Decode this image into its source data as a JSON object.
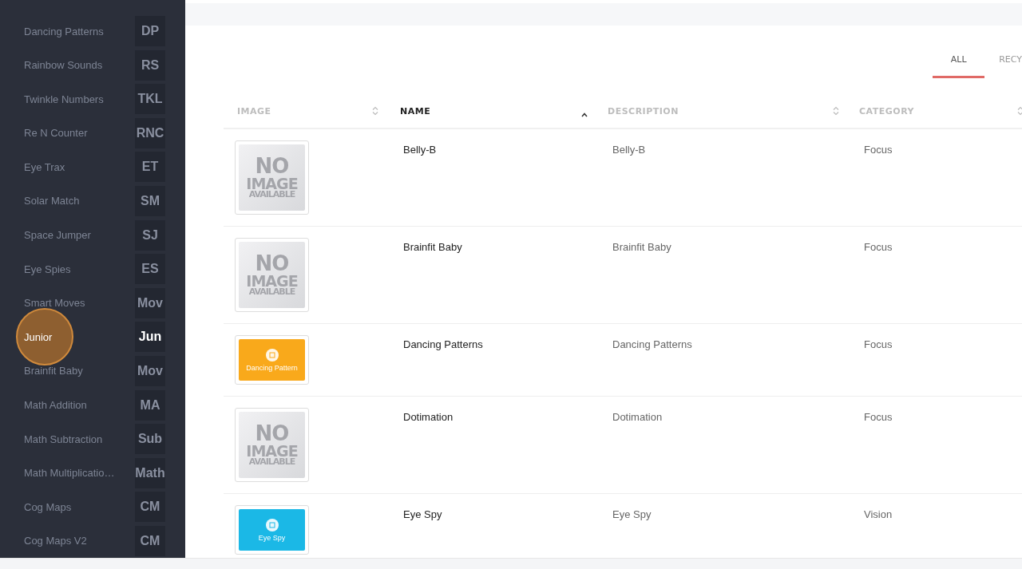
{
  "sidebar": {
    "items": [
      {
        "label": "Dancing Patterns",
        "abbr": "DP",
        "selected": false,
        "clicked": false
      },
      {
        "label": "Rainbow Sounds",
        "abbr": "RS",
        "selected": false,
        "clicked": false
      },
      {
        "label": "Twinkle Numbers",
        "abbr": "TKL",
        "selected": false,
        "clicked": false
      },
      {
        "label": "Re N Counter",
        "abbr": "RNC",
        "selected": false,
        "clicked": false
      },
      {
        "label": "Eye Trax",
        "abbr": "ET",
        "selected": false,
        "clicked": false
      },
      {
        "label": "Solar Match",
        "abbr": "SM",
        "selected": false,
        "clicked": false
      },
      {
        "label": "Space Jumper",
        "abbr": "SJ",
        "selected": false,
        "clicked": false
      },
      {
        "label": "Eye Spies",
        "abbr": "ES",
        "selected": false,
        "clicked": false
      },
      {
        "label": "Smart Moves",
        "abbr": "Mov",
        "selected": false,
        "clicked": false
      },
      {
        "label": "Junior",
        "abbr": "Jun",
        "selected": true,
        "clicked": true
      },
      {
        "label": "Brainfit Baby",
        "abbr": "Mov",
        "selected": false,
        "clicked": false
      },
      {
        "label": "Math Addition",
        "abbr": "MA",
        "selected": false,
        "clicked": false
      },
      {
        "label": "Math Subtraction",
        "abbr": "Sub",
        "selected": false,
        "clicked": false
      },
      {
        "label": "Math Multiplicatio…",
        "abbr": "Math",
        "selected": false,
        "clicked": false
      },
      {
        "label": "Cog Maps",
        "abbr": "CM",
        "selected": false,
        "clicked": false
      },
      {
        "label": "Cog Maps V2",
        "abbr": "CM",
        "selected": false,
        "clicked": false
      }
    ]
  },
  "tabs": [
    {
      "label": "ALL",
      "selected": true
    },
    {
      "label": "RECY",
      "selected": false
    }
  ],
  "table": {
    "columns": [
      {
        "label": "IMAGE",
        "sorted": false
      },
      {
        "label": "NAME",
        "sorted": true
      },
      {
        "label": "DESCRIPTION",
        "sorted": false
      },
      {
        "label": "CATEGORY",
        "sorted": false
      }
    ],
    "rows": [
      {
        "image": {
          "kind": "placeholder",
          "lines": [
            "NO",
            "IMAGE",
            "AVAILABLE"
          ]
        },
        "name": "Belly-B",
        "description": "Belly-B",
        "category": "Focus"
      },
      {
        "image": {
          "kind": "placeholder",
          "lines": [
            "NO",
            "IMAGE",
            "AVAILABLE"
          ]
        },
        "name": "Brainfit Baby",
        "description": "Brainfit Baby",
        "category": "Focus"
      },
      {
        "image": {
          "kind": "tile",
          "label": "Dancing Pattern",
          "color": "#f9a91b"
        },
        "name": "Dancing Patterns",
        "description": "Dancing Patterns",
        "category": "Focus"
      },
      {
        "image": {
          "kind": "placeholder",
          "lines": [
            "NO",
            "IMAGE",
            "AVAILABLE"
          ]
        },
        "name": "Dotimation",
        "description": "Dotimation",
        "category": "Focus"
      },
      {
        "image": {
          "kind": "tile",
          "label": "Eye Spy",
          "color": "#1bb8e6"
        },
        "name": "Eye Spy",
        "description": "Eye Spy",
        "category": "Vision"
      }
    ]
  }
}
